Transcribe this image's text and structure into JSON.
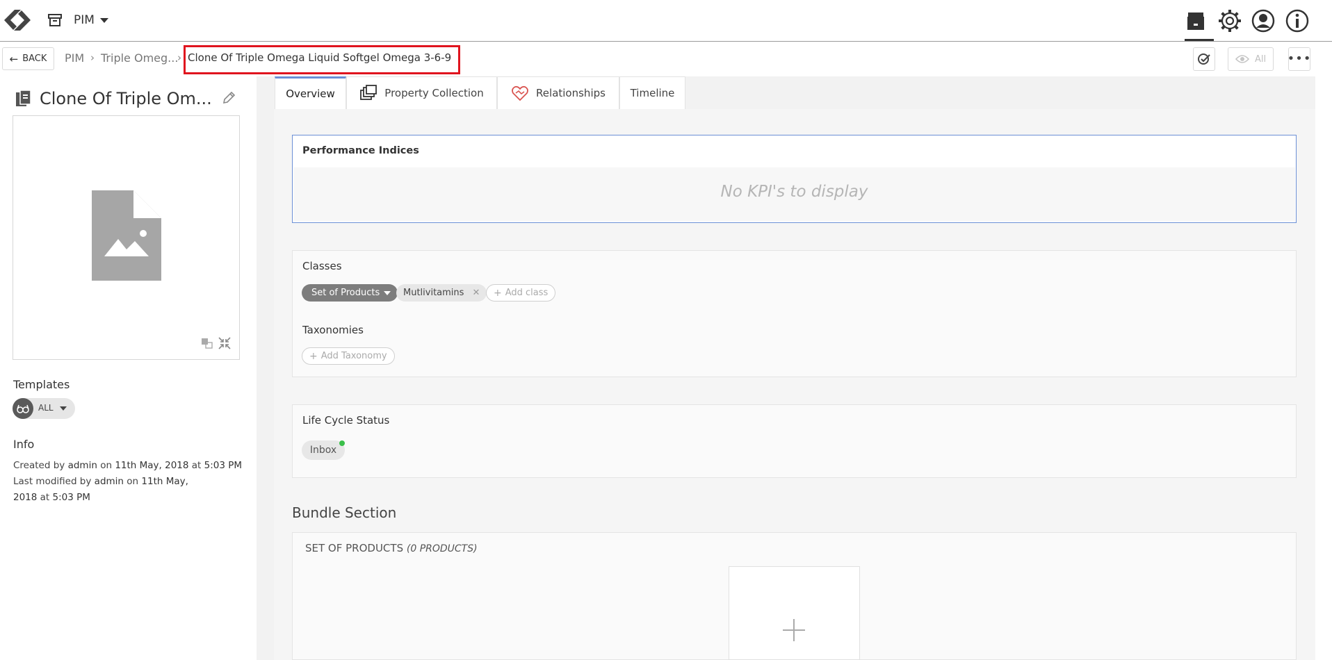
{
  "topbar": {
    "module_label": "PIM",
    "icons": [
      "logo-icon",
      "archive-icon",
      "tasks-icon",
      "gear-icon",
      "user-icon",
      "info-icon"
    ]
  },
  "subbar": {
    "back_label": "BACK",
    "breadcrumb": [
      "PIM",
      "Triple Omeg...",
      "Clone Of Triple Omega Liquid Softgel Omega 3-6-9"
    ],
    "view_all_label": "All"
  },
  "entity": {
    "title": "Clone Of Triple Om...",
    "templates_label": "Templates",
    "template_value": "ALL",
    "info_label": "Info",
    "created_prefix": "Created by",
    "created_by": "admin",
    "created_on_word": "on",
    "created_date": "11th May, 2018",
    "at_word": "at",
    "created_time": "5:03 PM",
    "modified_prefix": "Last modified by",
    "modified_by": "admin",
    "modified_on_word": "on",
    "modified_date_part1": "11th May,",
    "modified_date_part2": "2018",
    "modified_time": "5:03 PM"
  },
  "tabs": [
    {
      "label": "Overview",
      "active": true
    },
    {
      "label": "Property Collection",
      "active": false
    },
    {
      "label": "Relationships",
      "active": false
    },
    {
      "label": "Timeline",
      "active": false
    }
  ],
  "overview": {
    "kpi_title": "Performance Indices",
    "kpi_empty": "No KPI's to display",
    "classes_title": "Classes",
    "class_primary": "Set of Products",
    "class_secondary": "Mutlivitamins",
    "add_class": "Add class",
    "taxonomies_title": "Taxonomies",
    "add_taxonomy": "Add Taxonomy",
    "lifecycle_title": "Life Cycle Status",
    "lifecycle_value": "Inbox",
    "bundle_heading": "Bundle Section",
    "bundle_title": "SET OF PRODUCTS",
    "bundle_count": "(0 PRODUCTS)"
  },
  "colors": {
    "highlight": "#e0141e",
    "active_tab": "#6b8fd6",
    "status_dot": "#3bbf4a"
  }
}
